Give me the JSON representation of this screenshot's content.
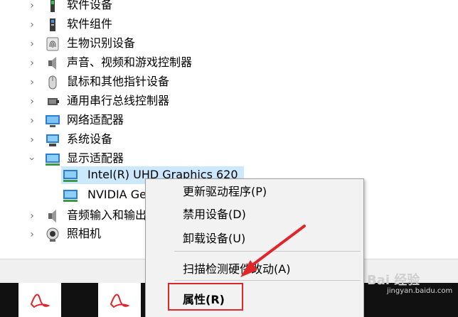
{
  "device_tree": {
    "items": [
      {
        "label": "软件设备",
        "icon": "software-device-icon",
        "state": "collapsed"
      },
      {
        "label": "软件组件",
        "icon": "software-component-icon",
        "state": "collapsed"
      },
      {
        "label": "生物识别设备",
        "icon": "fingerprint-icon",
        "state": "collapsed"
      },
      {
        "label": "声音、视频和游戏控制器",
        "icon": "speaker-icon",
        "state": "collapsed"
      },
      {
        "label": "鼠标和其他指针设备",
        "icon": "mouse-icon",
        "state": "collapsed"
      },
      {
        "label": "通用串行总线控制器",
        "icon": "usb-icon",
        "state": "collapsed"
      },
      {
        "label": "网络适配器",
        "icon": "network-icon",
        "state": "collapsed"
      },
      {
        "label": "系统设备",
        "icon": "system-device-icon",
        "state": "collapsed"
      },
      {
        "label": "显示适配器",
        "icon": "display-adapter-icon",
        "state": "expanded"
      }
    ],
    "children": [
      {
        "label": "Intel(R) UHD Graphics 620",
        "icon": "display-adapter-icon",
        "selected": true
      },
      {
        "label": "NVIDIA Ge",
        "icon": "display-adapter-icon",
        "selected": false
      }
    ],
    "after_items": [
      {
        "label": "音频输入和输出",
        "icon": "audio-io-icon",
        "state": "collapsed"
      },
      {
        "label": "照相机",
        "icon": "camera-icon",
        "state": "collapsed"
      }
    ]
  },
  "context_menu": {
    "items": [
      {
        "label": "更新驱动程序(P)"
      },
      {
        "label": "禁用设备(D)"
      },
      {
        "label": "卸载设备(U)"
      },
      {
        "label": "扫描检测硬件改动(A)"
      },
      {
        "label": "属性(R)",
        "bold": true
      }
    ]
  },
  "watermark": {
    "text": "Bai  经验",
    "sub": "jingyan.baidu.com"
  },
  "colors": {
    "selection": "#cce8ff",
    "highlight": "#e0262b",
    "menu_bg": "#f2f2f2"
  }
}
